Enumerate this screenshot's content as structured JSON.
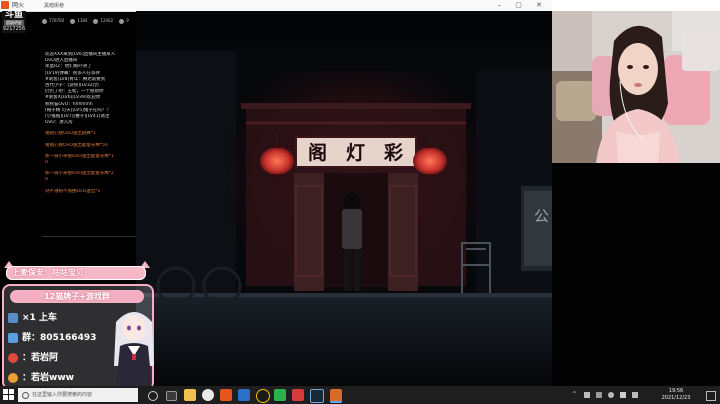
{
  "window": {
    "title": "网火",
    "tab_title": "黑暗街巷"
  },
  "streamer": {
    "id_top": "斗鱼",
    "badge": "超级明星",
    "room_id": "9217256"
  },
  "stats": [
    {
      "icon": "fans-icon",
      "value": "778780"
    },
    {
      "icon": "heat-icon",
      "value": "1184"
    },
    {
      "icon": "gift-icon",
      "value": "12462"
    },
    {
      "icon": "share-icon",
      "value": "9"
    }
  ],
  "chat": {
    "messages": [
      {
        "text": "欢迎XXX来到[LV6]直播间主播某人",
        "type": "normal"
      },
      {
        "text": "OvO进入直播间",
        "type": "normal"
      },
      {
        "text": "笨蛋RZ：他们被吓哭了",
        "type": "normal"
      },
      {
        "text": "[LV19]弹幕：很多人在等待",
        "type": "normal"
      },
      {
        "text": "#刺客[LV8]青年：腾达就要到",
        "type": "normal"
      },
      {
        "text": "古代小子：[游侠][LV32]仍",
        "type": "normal"
      },
      {
        "text": "仍仍了吧：王松，一个很烦你",
        "type": "normal"
      },
      {
        "text": "#刺客X[LV6][LV39]欢迎你",
        "type": "normal"
      },
      {
        "text": "秋秋猫OvO：hhhhhhh",
        "type": "normal"
      },
      {
        "text": "[帽子精 可天][LV5]猪子在吗？？",
        "type": "normal"
      },
      {
        "text": "[小猴猴][LV7][稚子][LV41]请注",
        "type": "normal"
      },
      {
        "text": "OvO：进入房",
        "type": "normal"
      },
      {
        "text": "猪猪心搜OvO送出跳舞*1",
        "type": "gift",
        "sep": true
      },
      {
        "text": "猪猪心搜OvO送出能量光棒*50",
        "type": "gift",
        "sep": true
      },
      {
        "text": "新一骑小米搜OvO送出能量光棒*1",
        "type": "gift",
        "sep": true
      },
      {
        "text": "0",
        "type": "gift"
      },
      {
        "text": "新一骑小米搜OvO送出能量光棒*2",
        "type": "gift",
        "sep": true
      },
      {
        "text": "0",
        "type": "gift"
      },
      {
        "text": "刻不落粉不落搜OvO送出*1",
        "type": "gift",
        "sep": true
      }
    ]
  },
  "game": {
    "sign_main": "彩 灯 阁",
    "sign_main_chars": [
      "阁",
      "灯",
      "彩"
    ],
    "sign_right": "公 告 栏"
  },
  "overlay": {
    "manager_label": "上麦保安：咕咕宝贝",
    "panel_title": "12猫牌子+游戏群",
    "rows": [
      {
        "icon": "user-icon",
        "text": "×1 上车"
      },
      {
        "icon": "group-icon",
        "text": "群：805166493"
      },
      {
        "icon": "weibo-icon",
        "text": "：若岩阿"
      },
      {
        "icon": "weibo-icon",
        "text": "：若岩www"
      }
    ]
  },
  "taskbar": {
    "search_placeholder": "在这里输入你要搜索的内容",
    "time": "19:56",
    "date": "2021/12/23"
  },
  "colors": {
    "accent_pink": "#f4b0c2",
    "lantern_red": "#d23a32",
    "gift_orange": "#e07b3a"
  }
}
